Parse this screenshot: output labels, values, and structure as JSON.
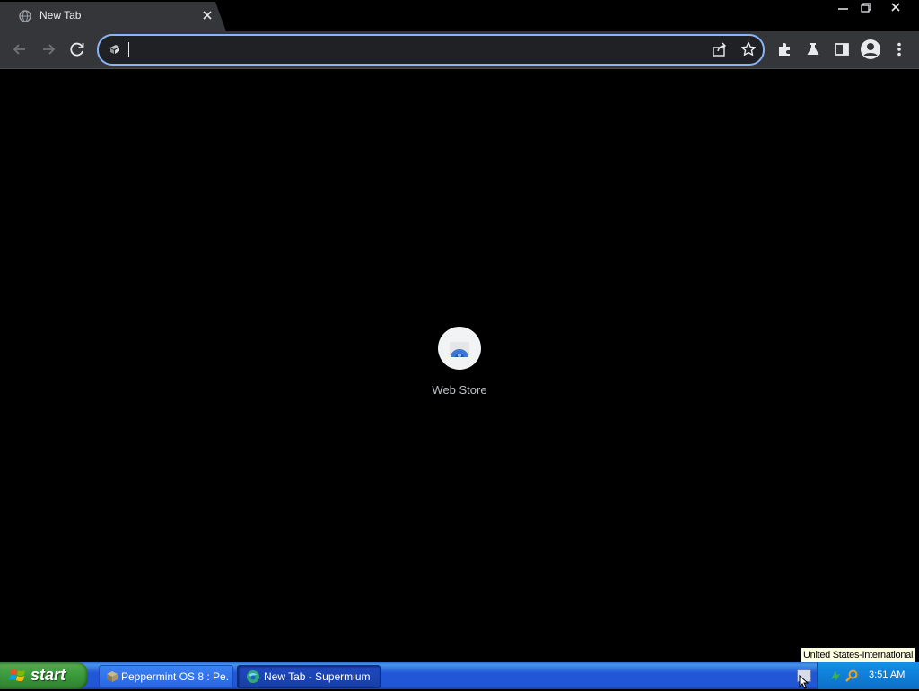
{
  "browser": {
    "tab": {
      "title": "New Tab"
    },
    "omnibox": {
      "value": "",
      "placeholder": ""
    }
  },
  "new_tab": {
    "shortcuts": [
      {
        "label": "Web Store"
      }
    ]
  },
  "tooltip": {
    "text": "United States-International"
  },
  "taskbar": {
    "start_label": "start",
    "tasks": [
      {
        "label": "Peppermint OS 8 : Pe...",
        "icon": "package-icon",
        "active": false
      },
      {
        "label": "New Tab - Supermium",
        "icon": "supermium-icon",
        "active": true
      }
    ],
    "clock": "3:51 AM"
  },
  "colors": {
    "page_background": "#000000",
    "toolbar": "#35363a",
    "omnibox_focus": "#8ab4f8",
    "taskbar": "#2157d7",
    "start_button": "#3a9a3a"
  }
}
